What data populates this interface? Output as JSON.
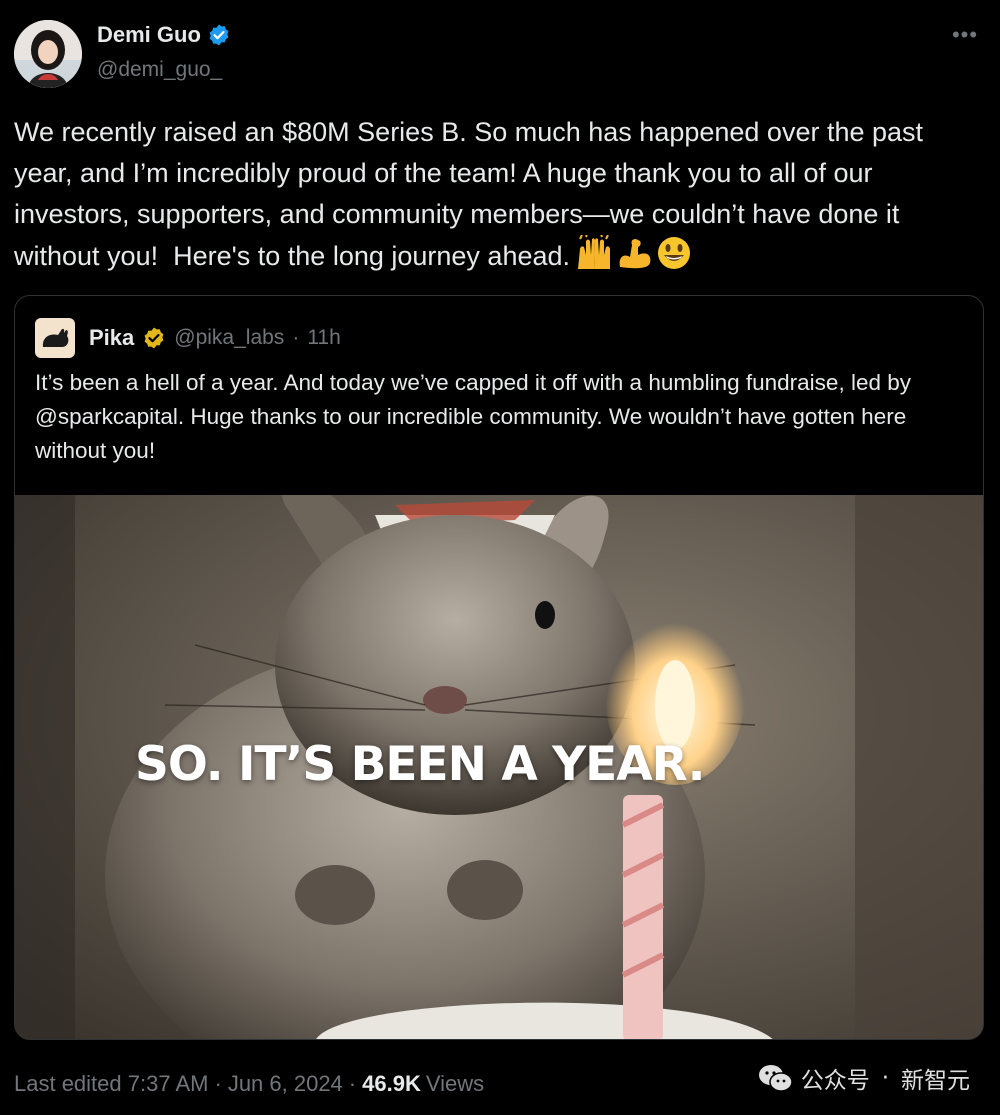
{
  "author": {
    "name": "Demi Guo",
    "handle": "@demi_guo_",
    "verified_color": "#1d9bf0"
  },
  "tweet": {
    "text": "We recently raised an $80M Series B. So much has happened over the past year, and I’m incredibly proud of the team! A huge thank you to all of our investors, supporters, and community members—we couldn’t have done it without you!  Here's to the long journey ahead.",
    "emojis": [
      "raising-hands-emoji",
      "flexed-biceps-emoji",
      "smiling-face-emoji"
    ]
  },
  "quote": {
    "name": "Pika",
    "handle": "@pika_labs",
    "separator": "·",
    "time": "11h",
    "verified_color": "#e2b719",
    "text": "It’s been a hell of a year. And today we’ve capped it off with a humbling fundraise, led by @sparkcapital. Huge thanks to our incredible community. We wouldn’t have gotten here without you!",
    "media": {
      "overlay_text": "SO. IT’S BEEN A YEAR."
    }
  },
  "footer": {
    "edited_label": "Last edited",
    "time": "7:37 AM",
    "separator": "·",
    "date": "Jun 6, 2024",
    "views_count": "46.9K",
    "views_label": "Views"
  },
  "watermark": {
    "text_left": "公众号",
    "separator": "·",
    "text_right": "新智元"
  },
  "colors": {
    "background": "#000000",
    "text_primary": "#e7e9ea",
    "text_secondary": "#71767b",
    "border": "#2f3336"
  }
}
